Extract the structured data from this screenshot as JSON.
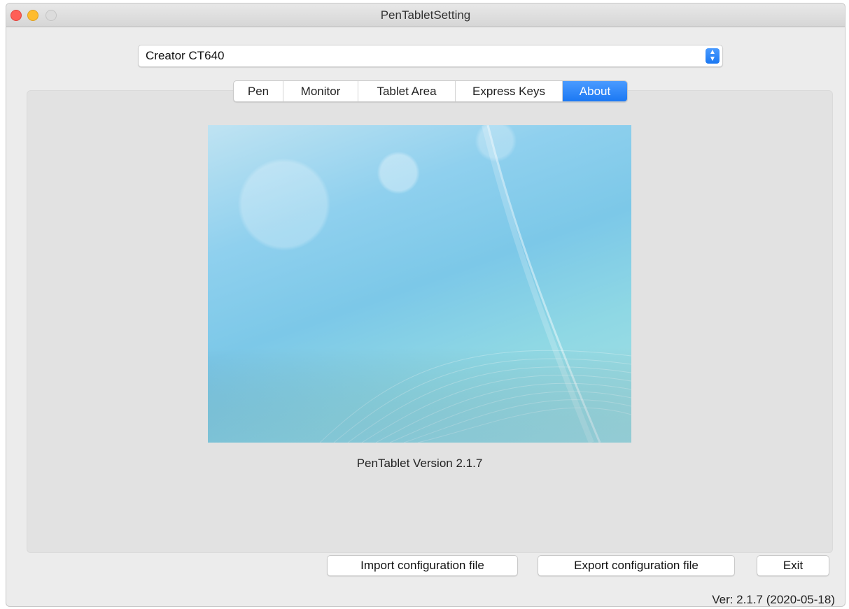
{
  "window": {
    "title": "PenTabletSetting"
  },
  "device_select": {
    "value": "Creator CT640"
  },
  "tabs": [
    {
      "label": "Pen",
      "active": false
    },
    {
      "label": "Monitor",
      "active": false
    },
    {
      "label": "Tablet Area",
      "active": false
    },
    {
      "label": "Express Keys",
      "active": false
    },
    {
      "label": "About",
      "active": true
    }
  ],
  "about": {
    "version_text": "PenTablet Version  2.1.7"
  },
  "buttons": {
    "import": "Import configuration file",
    "export": "Export configuration file",
    "exit": "Exit"
  },
  "footer": {
    "version": "Ver: 2.1.7 (2020-05-18)"
  },
  "colors": {
    "accent": "#1b78f3",
    "close": "#fe5f57",
    "minimize": "#febc2e",
    "zoom_disabled": "#dcdcdc"
  }
}
